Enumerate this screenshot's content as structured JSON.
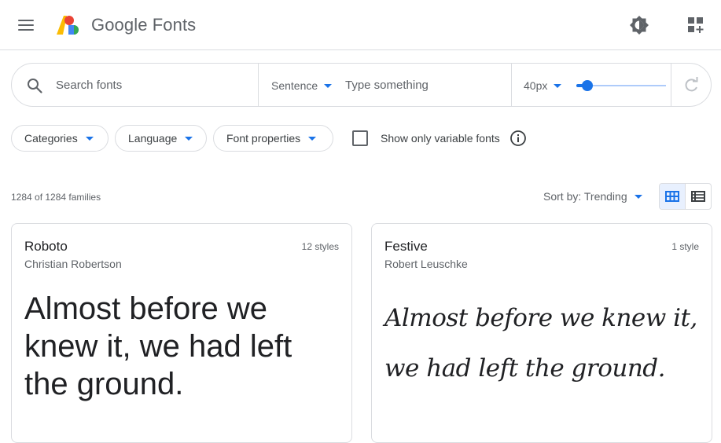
{
  "header": {
    "brand": "Google Fonts",
    "icons": [
      "menu-icon",
      "google-fonts-logo",
      "brightness-icon",
      "apps-add-icon"
    ],
    "logo_colors": [
      "#fbbc04",
      "#ea4335",
      "#4285f4",
      "#34a853"
    ]
  },
  "search": {
    "placeholder": "Search fonts",
    "preview_mode": "Sentence",
    "preview_placeholder": "Type something",
    "font_size": "40px",
    "font_size_slider_fraction": 0.12
  },
  "filters": {
    "categories": "Categories",
    "language": "Language",
    "font_properties": "Font properties",
    "variable_label": "Show only variable fonts",
    "variable_checked": false
  },
  "results": {
    "count": "1284 of 1284 families",
    "sort": "Sort by: Trending",
    "view_selected": "grid"
  },
  "cards": [
    {
      "name": "Roboto",
      "author": "Christian Robertson",
      "styles": "12 styles",
      "sample": "Almost before we knew it, we had left the ground."
    },
    {
      "name": "Festive",
      "author": "Robert Leuschke",
      "styles": "1 style",
      "sample": "Almost before we knew it, we had left the ground."
    }
  ],
  "colors": {
    "accent": "#1a73e8",
    "border": "#dadce0",
    "text_secondary": "#5f6368"
  }
}
